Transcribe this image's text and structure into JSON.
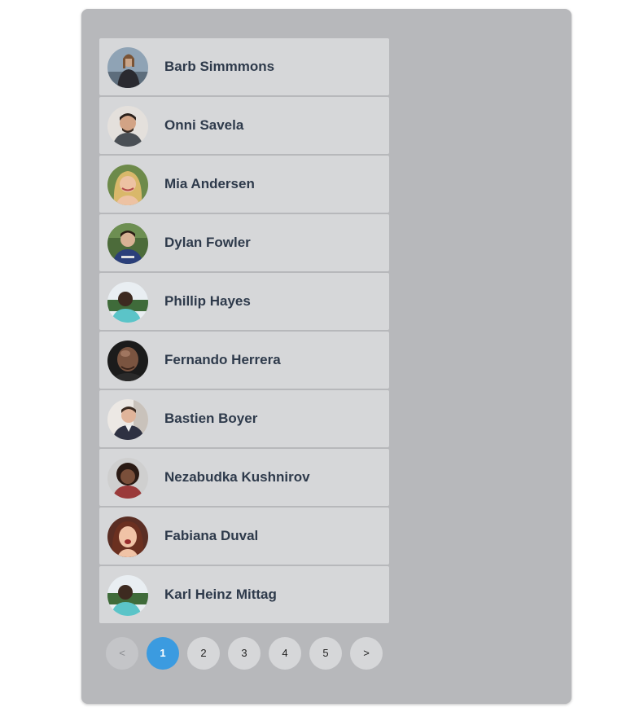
{
  "users": [
    {
      "name": "Barb Simmmons",
      "avatar": "avatar-photo-icon"
    },
    {
      "name": "Onni Savela",
      "avatar": "avatar-photo-icon"
    },
    {
      "name": "Mia Andersen",
      "avatar": "avatar-photo-icon"
    },
    {
      "name": "Dylan Fowler",
      "avatar": "avatar-photo-icon"
    },
    {
      "name": "Phillip Hayes",
      "avatar": "avatar-photo-icon"
    },
    {
      "name": "Fernando Herrera",
      "avatar": "avatar-photo-icon"
    },
    {
      "name": "Bastien Boyer",
      "avatar": "avatar-photo-icon"
    },
    {
      "name": "Nezabudka Kushnirov",
      "avatar": "avatar-photo-icon"
    },
    {
      "name": "Fabiana Duval",
      "avatar": "avatar-photo-icon"
    },
    {
      "name": "Karl Heinz Mittag",
      "avatar": "avatar-photo-icon"
    }
  ],
  "pagination": {
    "prev": "<",
    "pages": [
      "1",
      "2",
      "3",
      "4",
      "5"
    ],
    "next": ">",
    "current": "1"
  },
  "colors": {
    "panel_bg": "#b7b8bb",
    "row_bg": "#d6d7d9",
    "name_text": "#2e3a4b",
    "active_page": "#3b9be0"
  }
}
